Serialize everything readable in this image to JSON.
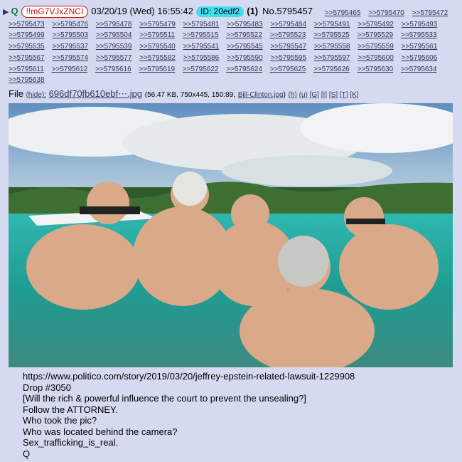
{
  "post": {
    "arrow": "▶",
    "name": "Q",
    "tripcode": "!!mG7VJxZNCI",
    "date": "03/20/19 (Wed) 16:55:42",
    "id_label": "ID: 20edf2",
    "count": "(1)",
    "post_number": "No.5795457"
  },
  "replies": [
    ">>5795465",
    ">>5795470",
    ">>5795472",
    ">>5795473",
    ">>5795476",
    ">>5795478",
    ">>5795479",
    ">>5795481",
    ">>5795483",
    ">>5795484",
    ">>5795491",
    ">>5795492",
    ">>5795493",
    ">>5795499",
    ">>5795503",
    ">>5795504",
    ">>5795511",
    ">>5795515",
    ">>5795522",
    ">>5795523",
    ">>5795525",
    ">>5795529",
    ">>5795533",
    ">>5795535",
    ">>5795537",
    ">>5795539",
    ">>5795540",
    ">>5795541",
    ">>5795545",
    ">>5795547",
    ">>5795558",
    ">>5795559",
    ">>5795561",
    ">>5795567",
    ">>5795574",
    ">>5795577",
    ">>5795582",
    ">>5795586",
    ">>5795590",
    ">>5795595",
    ">>5795597",
    ">>5795600",
    ">>5795606",
    ">>5795611",
    ">>5795612",
    ">>5795616",
    ">>5795619",
    ">>5795622",
    ">>5795624",
    ">>5795625",
    ">>5795626",
    ">>5795630",
    ">>5795634",
    ">>5795638"
  ],
  "file": {
    "label": "File",
    "hide": "(hide):",
    "filename": "696df70fb610ebf⋯.jpg",
    "meta": "(56.47 KB, 750x445, 150:89,",
    "original_name": "Bill-Clinton.jpg",
    "close": ")",
    "links": [
      "(h)",
      "(u)",
      "[G]",
      "[I]",
      "[S]",
      "[T]",
      "[K]"
    ]
  },
  "body_lines": [
    "https://www.politico.com/story/2019/03/20/jeffrey-epstein-related-lawsuit-1229908",
    "Drop #3050",
    "[Will the rich & powerful influence the court to prevent the unsealing?]",
    "Follow the ATTORNEY.",
    "Who took the pic?",
    "Who was located behind the camera?",
    "Sex_trafficking_is_real.",
    "Q"
  ],
  "colors": {
    "background": "#d6daf0",
    "name": "#117743",
    "trip": "#cc1105",
    "id_badge": "#3ee0f0",
    "link": "#34345c"
  }
}
